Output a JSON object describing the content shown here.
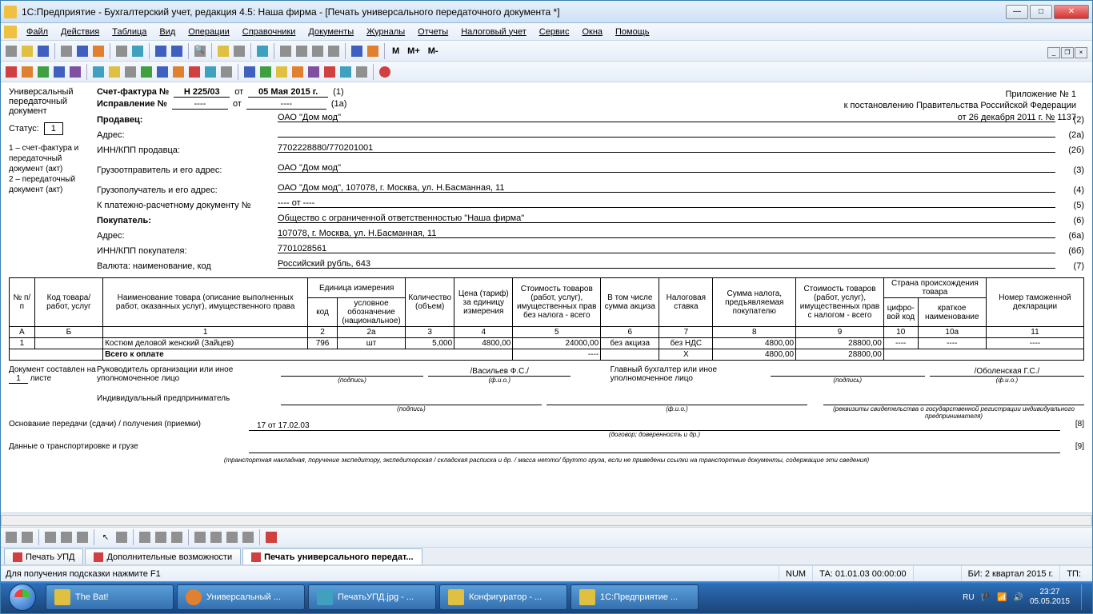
{
  "title": "1С:Предприятие - Бухгалтерский учет, редакция 4.5: Наша фирма - [Печать универсального передаточного документа *]",
  "menu": [
    "Файл",
    "Действия",
    "Таблица",
    "Вид",
    "Операции",
    "Справочники",
    "Документы",
    "Журналы",
    "Отчеты",
    "Налоговый учет",
    "Сервис",
    "Окна",
    "Помощь"
  ],
  "m_buttons": [
    "M",
    "M+",
    "M-"
  ],
  "left": {
    "hdr": "Универсальный передаточный документ",
    "status_lbl": "Статус:",
    "status_val": "1",
    "note": "1 – счет-фактура и передаточный документ (акт)\n2 – передаточный документ (акт)"
  },
  "appx": {
    "l1": "Приложение № 1",
    "l2": "к постановлению Правительства Российской Федерации",
    "l3": "от 26 декабря 2011 г. № 1137"
  },
  "hdr": {
    "invoice_lbl": "Счет-фактура №",
    "invoice_no": "Н 225/03",
    "from": "от",
    "invoice_date": "05 Мая 2015 г.",
    "n1": "(1)",
    "corr_lbl": "Исправление №",
    "corr_no": "----",
    "corr_date": "----",
    "n1a": "(1а)",
    "seller_lbl": "Продавец:",
    "seller": "ОАО \"Дом мод\"",
    "n2": "(2)",
    "addr_lbl": "Адрес:",
    "n2a": "(2а)",
    "inn_lbl": "ИНН/КПП продавца:",
    "inn": "7702228880/770201001",
    "n2b": "(2б)",
    "shipper_lbl": "Грузоотправитель и его адрес:",
    "shipper": "ОАО \"Дом мод\"",
    "n3": "(3)",
    "consignee_lbl": "Грузополучатель и его адрес:",
    "consignee": "ОАО \"Дом мод\", 107078, г. Москва, ул. Н.Басманная, 11",
    "n4": "(4)",
    "paydoc_lbl": "К платежно-расчетному документу №",
    "paydoc": "----   от  ----",
    "n5": "(5)",
    "buyer_lbl": "Покупатель:",
    "buyer": "Общество с ограниченной ответственностью \"Наша фирма\"",
    "n6": "(6)",
    "baddr_lbl": "Адрес:",
    "baddr": "107078, г. Москва, ул. Н.Басманная, 11",
    "n6a": "(6а)",
    "binn_lbl": "ИНН/КПП покупателя:",
    "binn": "7701028561",
    "n6b": "(6б)",
    "cur_lbl": "Валюта: наименование, код",
    "cur": "Российский рубль, 643",
    "n7": "(7)"
  },
  "thead": {
    "c_a": "№ п/п",
    "c_b": "Код товара/ работ, услуг",
    "c1": "Наименование товара (описание выполненных работ, оказанных услуг), имущественного права",
    "c2g": "Единица измерения",
    "c2": "код",
    "c2a": "условное обозначе­ние (нацио­нальное)",
    "c3": "Коли­чество (объем)",
    "c4": "Цена (тариф) за единицу измерения",
    "c5": "Стоимость товаров (работ, услуг), имуществен­ных прав без налога - всего",
    "c6": "В том числе сумма акциза",
    "c7": "Налого­вая ставка",
    "c8": "Сумма налога, предъяв­ляемая покупателю",
    "c9": "Стоимость товаров (работ, услуг), имуществен­ных прав с налогом - всего",
    "c10g": "Страна происхождения товара",
    "c10": "циф­ро­вой код",
    "c10a": "краткое наименова­ние",
    "c11": "Номер таможенной декларации"
  },
  "tnum": {
    "a": "А",
    "b": "Б",
    "c1": "1",
    "c2": "2",
    "c2a": "2а",
    "c3": "3",
    "c4": "4",
    "c5": "5",
    "c6": "6",
    "c7": "7",
    "c8": "8",
    "c9": "9",
    "c10": "10",
    "c10a": "10а",
    "c11": "11"
  },
  "row": {
    "n": "1",
    "name": "Костюм деловой женский (Зайцев)",
    "code": "796",
    "unit": "шт",
    "qty": "5,000",
    "price": "4800,00",
    "sum": "24000,00",
    "excise": "без акциза",
    "vat": "без НДС",
    "tax": "4800,00",
    "total": "28800,00",
    "ccode": "----",
    "cname": "----",
    "decl": "----"
  },
  "totals": {
    "lbl": "Всего к оплате",
    "d1": "----",
    "x": "Х",
    "tax": "4800,00",
    "total": "28800,00"
  },
  "sign": {
    "doc_lbl": "Документ составлен на",
    "sheets": "1",
    "sheets_lbl": "листе",
    "head_lbl": "Руководитель организации или иное уполномоченное лицо",
    "head_name": "/Васильев Ф.С./",
    "acc_lbl": "Главный бухгалтер или иное уполномоченное лицо",
    "acc_name": "/Оболенская Г.С./",
    "sub_sign": "(подпись)",
    "sub_fio": "(ф.и.о.)",
    "ip_lbl": "Индивидуальный предприниматель",
    "ip_sub": "(реквизиты свидетельства о государственной регистрации индивидуального предпринимателя)",
    "basis_lbl": "Основание передачи (сдачи) / получения (приемки)",
    "basis_val": "17 от 17.02.03",
    "basis_sub": "(договор; доверенность и др.)",
    "basis_n": "[8]",
    "trans_lbl": "Данные о транспортировке и грузе",
    "trans_sub": "(транспортная накладная, поручение экспедитору, экспедиторская / складская расписка и др. / масса нетто/ брутто груза, если не приведены ссылки на транспортные документы, содержащие эти сведения)",
    "trans_n": "[9]"
  },
  "tabs": {
    "t1": "Печать УПД",
    "t2": "Дополнительные возможности",
    "t3": "Печать универсального передат..."
  },
  "status": {
    "hint": "Для получения подсказки нажмите F1",
    "num": "NUM",
    "ta": "ТА: 01.01.03 00:00:00",
    "bi": "БИ: 2 квартал 2015 г.",
    "tp": "ТП:"
  },
  "taskbar": {
    "b1": "The Bat!",
    "b2": "Универсальный ...",
    "b3": "ПечатьУПД.jpg - ...",
    "b4": "Конфигуратор - ...",
    "b5": "1С:Предприятие ...",
    "lang": "RU",
    "time": "23:27",
    "date": "05.05.2015"
  }
}
